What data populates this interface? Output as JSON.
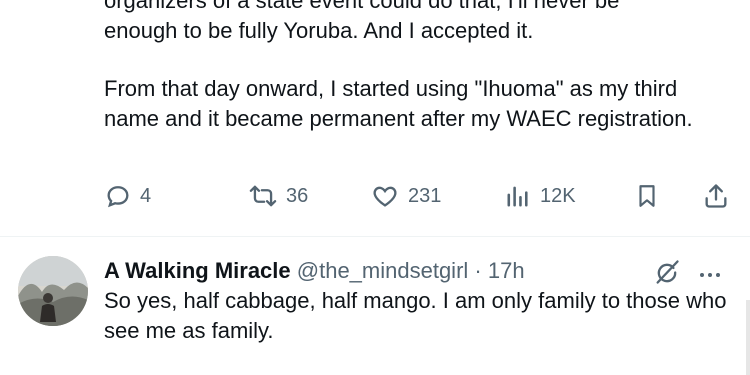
{
  "tweet": {
    "para_top_hidden": "organizers of a state event could do that, I'll never be",
    "para_top_visible": "enough to be fully Yoruba. And I accepted it.",
    "para_two": "From that day onward, I started using \"Ihuoma\" as my third name and it became permanent after my WAEC registration.",
    "actions": {
      "replies": "4",
      "reposts": "36",
      "likes": "231",
      "views": "12K"
    },
    "icons": {
      "reply": "comment-icon",
      "repost": "repost-icon",
      "like": "heart-icon",
      "views": "bar-chart-icon",
      "bookmark": "bookmark-icon",
      "share": "share-icon"
    }
  },
  "reply": {
    "display_name": "A Walking Miracle",
    "handle": "@the_mindsetgirl",
    "separator": "·",
    "time": "17h",
    "text": "So yes, half cabbage, half mango. I am only family to those who see me as family.",
    "icons": {
      "grok": "grok-icon",
      "more": "more-icon"
    }
  },
  "colors": {
    "text": "#0f1419",
    "muted": "#536471",
    "divider": "#eff3f4"
  }
}
